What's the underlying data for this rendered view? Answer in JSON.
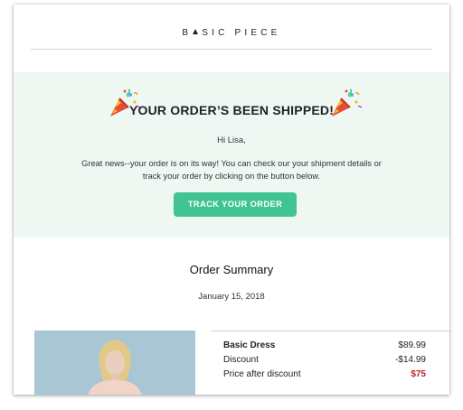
{
  "brand": {
    "name_before": "B",
    "name_after": "SIC PIECE"
  },
  "hero": {
    "headline": "YOUR ORDER’S BEEN SHIPPED!",
    "greeting": "Hi Lisa,",
    "body": "Great news--your order is on its way! You can check our your shipment details or track your order by clicking on the button below.",
    "button_label": "TRACK YOUR ORDER",
    "background": "#eef7f2",
    "button_color": "#41c493"
  },
  "summary": {
    "title": "Order Summary",
    "date": "January 15, 2018",
    "item_name": "Basic Dress",
    "item_price": "$89.99",
    "discount_label": "Discount",
    "discount_value": "-$14.99",
    "final_label": "Price after discount",
    "final_value": "$75",
    "final_color": "#c0201f"
  },
  "icons": {
    "headline_left": "party-popper-icon",
    "headline_right": "party-popper-icon",
    "brand_a": "triangle-a-glyph"
  }
}
